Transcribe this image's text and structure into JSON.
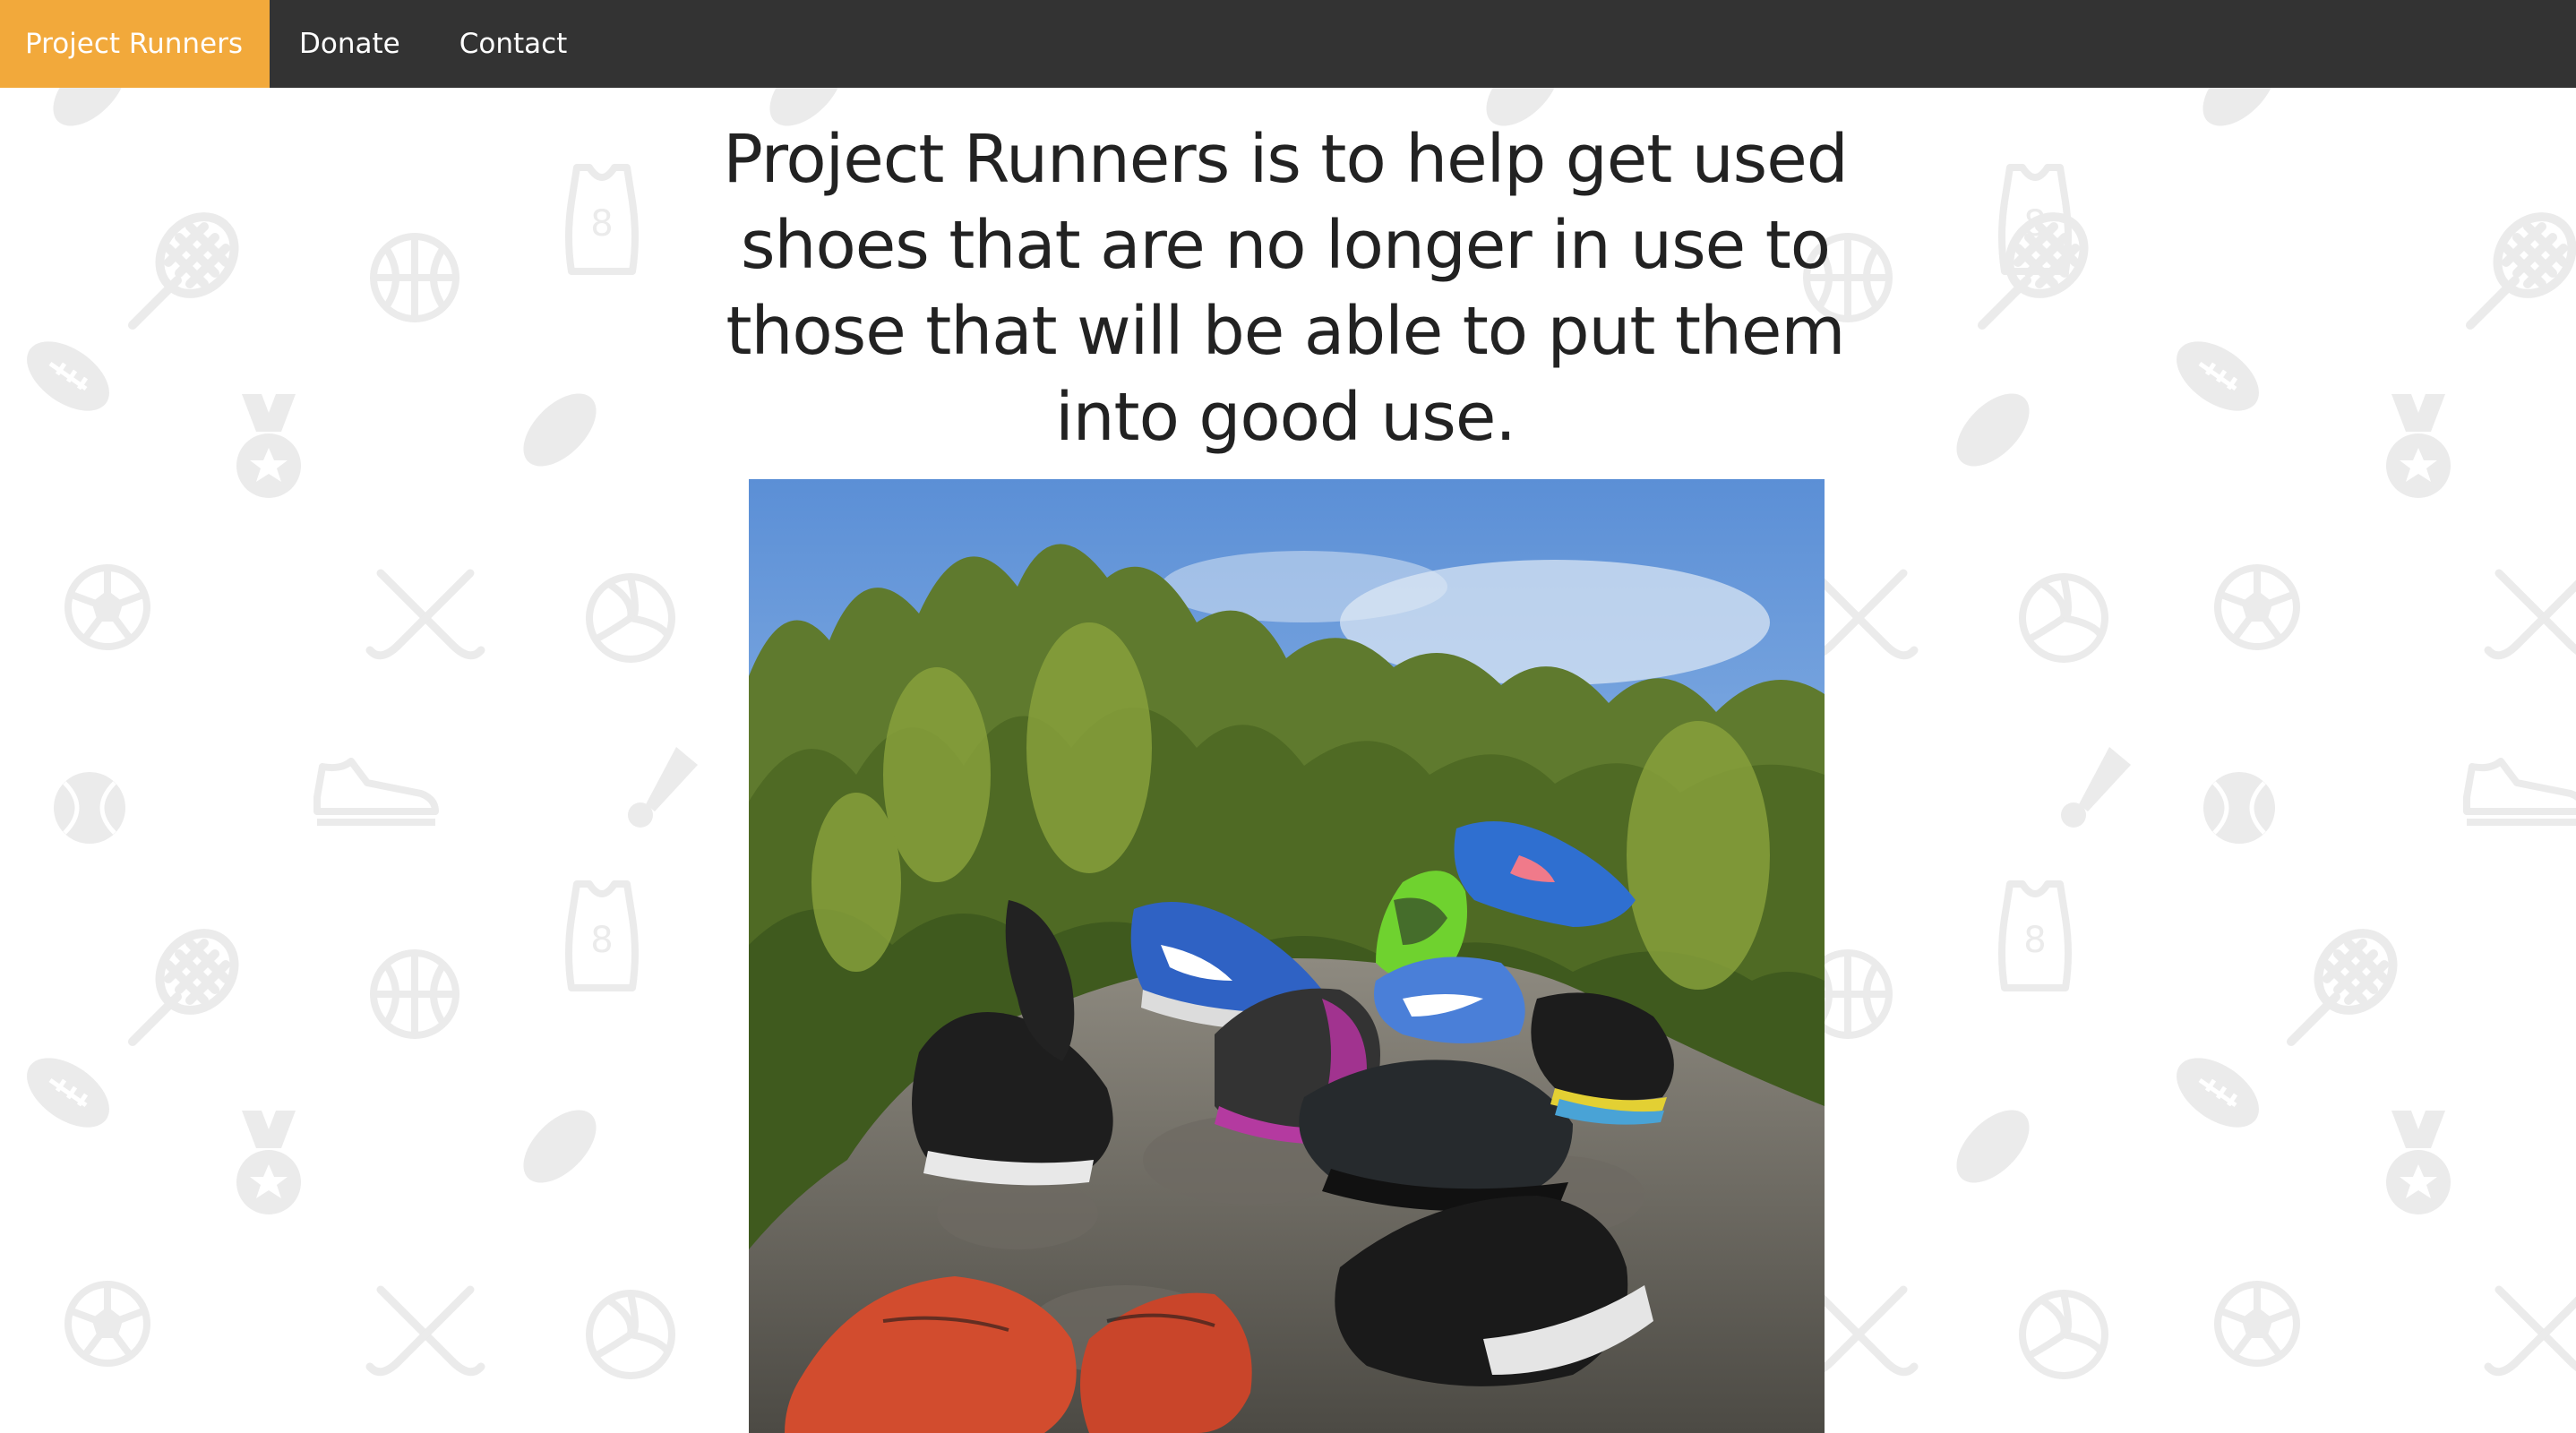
{
  "nav": {
    "items": [
      {
        "label": "Project Runners",
        "active": true
      },
      {
        "label": "Donate",
        "active": false
      },
      {
        "label": "Contact",
        "active": false
      }
    ]
  },
  "main": {
    "mission": "Project Runners is to help get used shoes that are no longer in use to those that will be able to put them into good use."
  },
  "colors": {
    "navbar": "#333333",
    "nav_active": "#f2a93b",
    "nav_text": "#ffffff",
    "page_bg": "#ffffff",
    "pattern": "#ececec",
    "heading": "#222222"
  },
  "icons": {
    "background_pattern": [
      "tennis-racket",
      "basketball",
      "jersey",
      "football",
      "medal",
      "hockey-puck",
      "soccer-ball",
      "hockey-sticks",
      "volleyball",
      "tennis-ball",
      "sneaker",
      "shuttlecock"
    ]
  },
  "image": {
    "subject": "photo-of-running-shoes-on-rock"
  }
}
